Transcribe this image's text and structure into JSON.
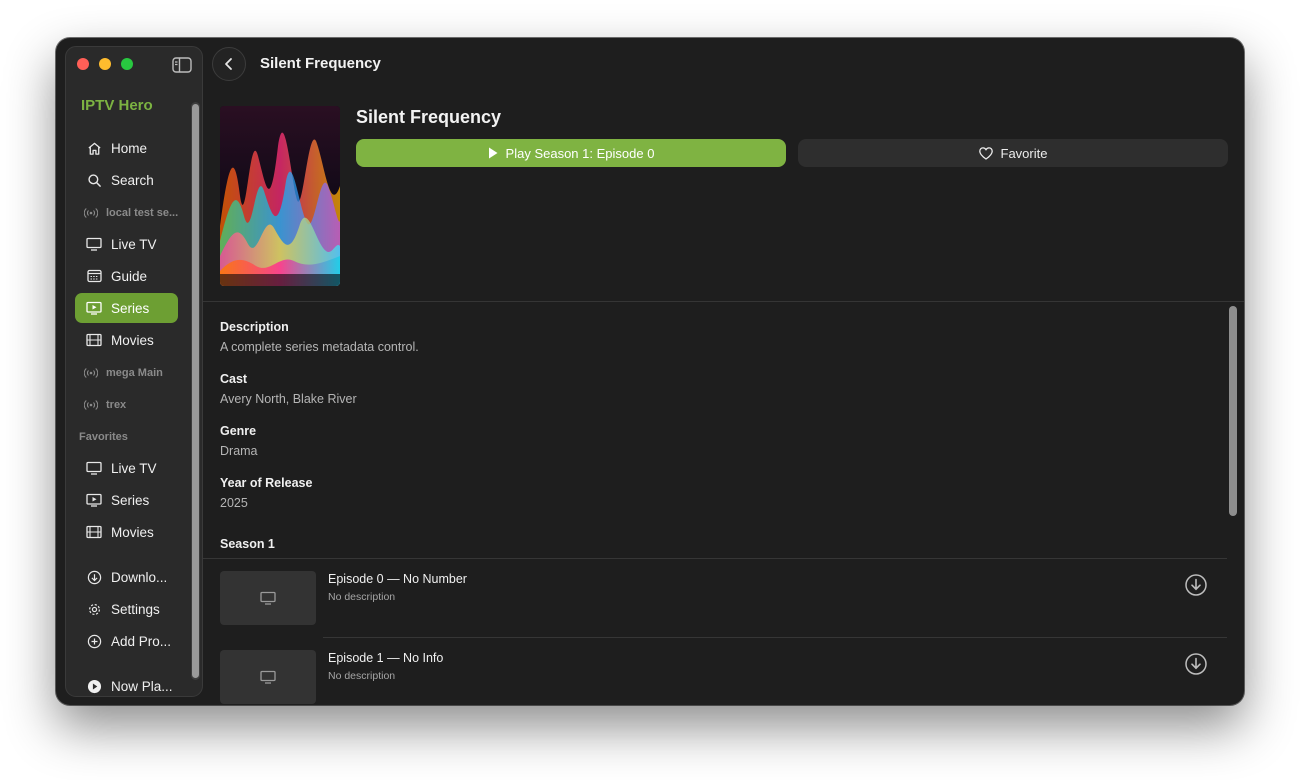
{
  "app": {
    "brand": "IPTV Hero",
    "window_title": "Silent Frequency",
    "accent_color": "#7fb342"
  },
  "sidebar": {
    "items": [
      {
        "label": "Home",
        "icon": "house-icon",
        "active": false
      },
      {
        "label": "Search",
        "icon": "magnifier-icon",
        "active": false
      }
    ],
    "providers": [
      {
        "name": "local test se...",
        "icon": "antenna-icon",
        "items": [
          {
            "label": "Live TV",
            "icon": "tv-icon",
            "active": false
          },
          {
            "label": "Guide",
            "icon": "calendar-grid-icon",
            "active": false
          },
          {
            "label": "Series",
            "icon": "play-rectangle-icon",
            "active": true
          },
          {
            "label": "Movies",
            "icon": "film-icon",
            "active": false
          }
        ]
      },
      {
        "name": "mega Main",
        "icon": "antenna-icon"
      },
      {
        "name": "trex",
        "icon": "antenna-icon"
      }
    ],
    "favorites": {
      "heading": "Favorites",
      "items": [
        {
          "label": "Live TV",
          "icon": "tv-icon"
        },
        {
          "label": "Series",
          "icon": "play-rectangle-icon"
        },
        {
          "label": "Movies",
          "icon": "film-icon"
        }
      ]
    },
    "bottom": [
      {
        "label": "Downlo...",
        "icon": "download-circle-icon"
      },
      {
        "label": "Settings",
        "icon": "gear-icon"
      },
      {
        "label": "Add Pro...",
        "icon": "plus-circle-icon"
      }
    ],
    "now_playing": {
      "label": "Now Pla...",
      "icon": "play-circle-filled-icon"
    }
  },
  "series": {
    "title": "Silent Frequency",
    "play_label": "Play Season 1: Episode 0",
    "favorite_label": "Favorite",
    "details": [
      {
        "label": "Description",
        "value": "A complete series metadata control."
      },
      {
        "label": "Cast",
        "value": "Avery North, Blake River"
      },
      {
        "label": "Genre",
        "value": "Drama"
      },
      {
        "label": "Year of Release",
        "value": "2025"
      }
    ],
    "season_label": "Season 1",
    "episodes": [
      {
        "title": "Episode 0 — No Number",
        "description": "No description"
      },
      {
        "title": "Episode 1 — No Info",
        "description": "No description"
      }
    ]
  }
}
